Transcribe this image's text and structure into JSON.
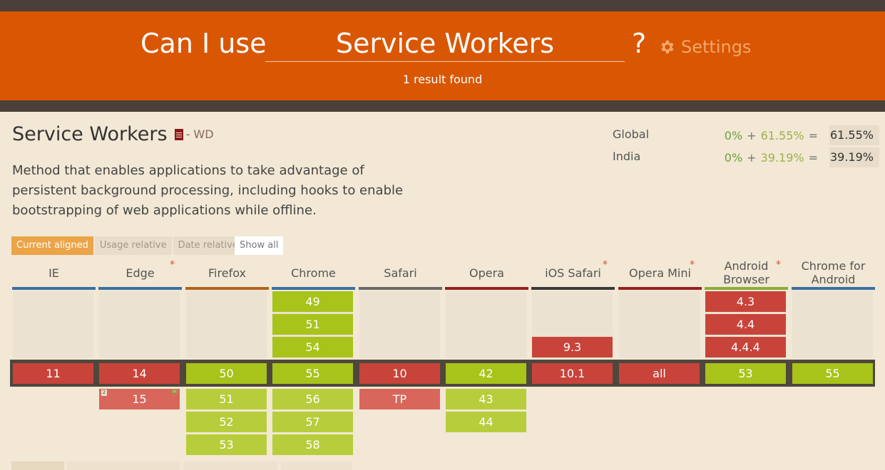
{
  "header": {
    "prefix": "Can I use",
    "query": "Service Workers",
    "question_mark": "?",
    "settings_label": "Settings",
    "settings_icon": "gear-icon",
    "result_text": "1 result found",
    "colors": {
      "header_bg": "#d95603",
      "strip": "#4a4039",
      "page_bg": "#f2e8d5"
    }
  },
  "feature": {
    "title": "Service Workers",
    "doc_icon": "document-icon",
    "status": "- WD",
    "description": "Method that enables applications to take advantage of persistent background processing, including hooks to enable bootstrapping of web applications while offline."
  },
  "stats": [
    {
      "region": "Global",
      "full": "0%",
      "plus": "+",
      "partial": "61.55%",
      "equals": "=",
      "total": "61.55%"
    },
    {
      "region": "India",
      "full": "0%",
      "plus": "+",
      "partial": "39.19%",
      "equals": "=",
      "total": "39.19%"
    }
  ],
  "view_tabs": [
    "Current aligned",
    "Usage relative",
    "Date relative"
  ],
  "show_all_label": "Show all",
  "browsers": [
    {
      "name": "IE",
      "star": "",
      "bar_color": "#3a6fa3",
      "past": [],
      "current": "11",
      "current_style": "red",
      "future": []
    },
    {
      "name": "Edge",
      "star": "*",
      "bar_color": "#3a6fa3",
      "past": [],
      "current": "14",
      "current_style": "red",
      "future": [
        {
          "v": "15",
          "style": "lred",
          "note": "2",
          "flag": "flag-icon"
        }
      ]
    },
    {
      "name": "Firefox",
      "star": "",
      "bar_color": "#b2641e",
      "past": [],
      "current": "50",
      "current_style": "green",
      "future": [
        {
          "v": "51",
          "style": "lgreen"
        },
        {
          "v": "52",
          "style": "lgreen"
        },
        {
          "v": "53",
          "style": "lgreen"
        }
      ]
    },
    {
      "name": "Chrome",
      "star": "",
      "bar_color": "#3a6fa3",
      "past": [
        {
          "v": "49",
          "style": "green"
        },
        {
          "v": "51",
          "style": "green"
        },
        {
          "v": "54",
          "style": "green"
        }
      ],
      "current": "55",
      "current_style": "green",
      "future": [
        {
          "v": "56",
          "style": "lgreen"
        },
        {
          "v": "57",
          "style": "lgreen"
        },
        {
          "v": "58",
          "style": "lgreen"
        }
      ]
    },
    {
      "name": "Safari",
      "star": "",
      "bar_color": "#6a6a6a",
      "past": [],
      "current": "10",
      "current_style": "red",
      "future": [
        {
          "v": "TP",
          "style": "lred"
        }
      ]
    },
    {
      "name": "Opera",
      "star": "",
      "bar_color": "#9a2020",
      "past": [],
      "current": "42",
      "current_style": "green",
      "future": [
        {
          "v": "43",
          "style": "lgreen"
        },
        {
          "v": "44",
          "style": "lgreen"
        }
      ]
    },
    {
      "name": "iOS Safari",
      "star": "*",
      "bar_color": "#3a3a3a",
      "past": [
        {
          "v": "9.3",
          "style": "red"
        }
      ],
      "current": "10.1",
      "current_style": "red",
      "future": []
    },
    {
      "name": "Opera Mini",
      "star": "*",
      "bar_color": "#9a2020",
      "past": [],
      "current": "all",
      "current_style": "red",
      "future": []
    },
    {
      "name": "Android Browser",
      "star": "*",
      "bar_color": "#8aae3a",
      "past": [
        {
          "v": "4.3",
          "style": "red"
        },
        {
          "v": "4.4",
          "style": "red"
        },
        {
          "v": "4.4.4",
          "style": "red"
        }
      ],
      "current": "53",
      "current_style": "green",
      "future": []
    },
    {
      "name": "Chrome for Android",
      "star": "",
      "bar_color": "#3a6fa3",
      "past": [],
      "current": "55",
      "current_style": "green",
      "future": []
    }
  ]
}
